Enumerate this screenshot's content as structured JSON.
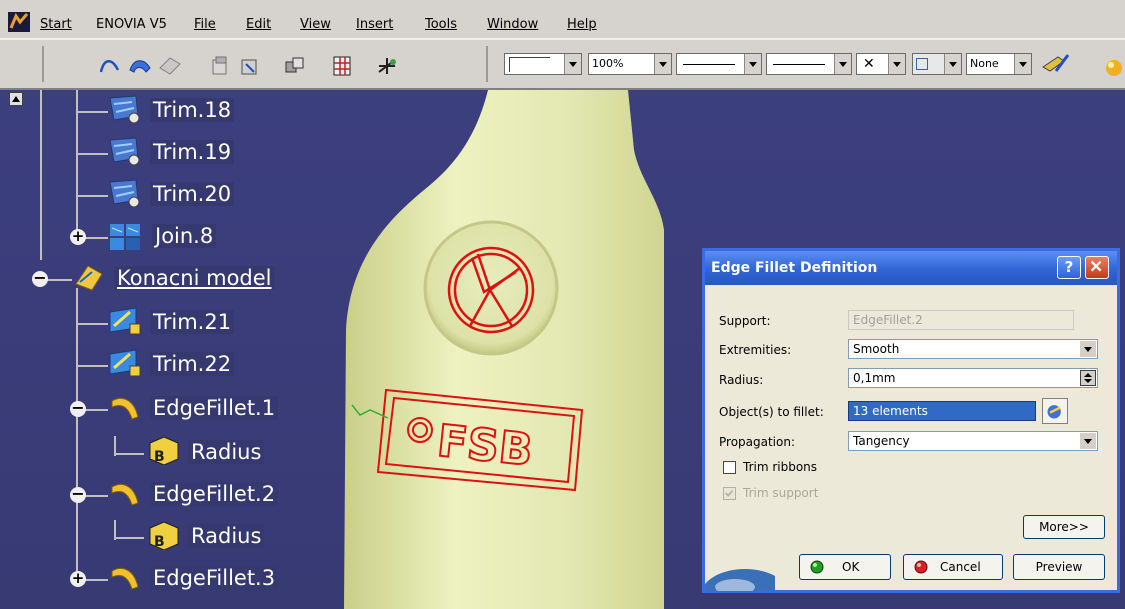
{
  "menu": {
    "items": [
      "Start",
      "ENOVIA V5",
      "File",
      "Edit",
      "View",
      "Insert",
      "Tools",
      "Window",
      "Help"
    ]
  },
  "toolbar": {
    "zoom_value": "100%",
    "layer_value": "None",
    "icons": [
      "curve-icon",
      "surface-icon",
      "plane-icon",
      "shell-icon",
      "fill-icon",
      "assembly-icon",
      "grid-icon",
      "axis-icon"
    ]
  },
  "tree": {
    "items": [
      {
        "label": "Trim.18",
        "icon": "trim-icon"
      },
      {
        "label": "Trim.19",
        "icon": "trim-icon"
      },
      {
        "label": "Trim.20",
        "icon": "trim-icon"
      },
      {
        "label": "Join.8",
        "icon": "join-icon"
      },
      {
        "label": "Konacni model",
        "icon": "geometrical-set-icon"
      },
      {
        "label": "Trim.21",
        "icon": "trim-icon"
      },
      {
        "label": "Trim.22",
        "icon": "trim-icon"
      },
      {
        "label": "EdgeFillet.1",
        "icon": "edge-fillet-icon"
      },
      {
        "label": "Radius",
        "icon": "radius-parameter-icon"
      },
      {
        "label": "EdgeFillet.2",
        "icon": "edge-fillet-icon"
      },
      {
        "label": "Radius",
        "icon": "radius-parameter-icon"
      },
      {
        "label": "EdgeFillet.3",
        "icon": "edge-fillet-icon"
      }
    ]
  },
  "model": {
    "emboss_text": "FSB",
    "body_color": "#e6ebb4",
    "engraving_color": "#dd1111"
  },
  "dialog": {
    "title": "Edge Fillet Definition",
    "support_label": "Support:",
    "support_value": "EdgeFillet.2",
    "extremities_label": "Extremities:",
    "extremities_value": "Smooth",
    "radius_label": "Radius:",
    "radius_value": "0,1mm",
    "objects_label": "Object(s) to fillet:",
    "objects_value": "13 elements",
    "propagation_label": "Propagation:",
    "propagation_value": "Tangency",
    "trim_ribbons_label": "Trim ribbons",
    "trim_ribbons_checked": false,
    "trim_support_label": "Trim support",
    "trim_support_checked": true,
    "more_label": "More>>",
    "ok_label": "OK",
    "cancel_label": "Cancel",
    "preview_label": "Preview",
    "help_label": "?"
  }
}
